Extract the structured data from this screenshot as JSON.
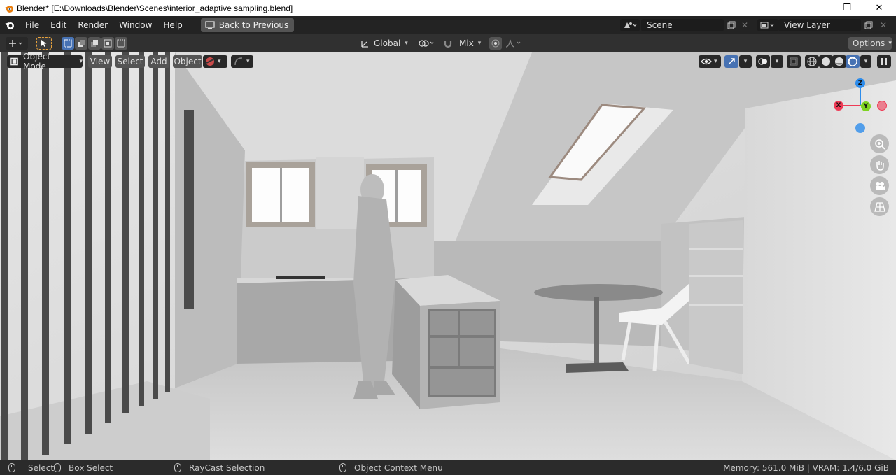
{
  "window": {
    "title": "Blender* [E:\\Downloads\\Blender\\Scenes\\interior_adaptive sampling.blend]",
    "minimize": "—",
    "maximize": "❐",
    "close": "✕"
  },
  "menubar": {
    "items": [
      "File",
      "Edit",
      "Render",
      "Window",
      "Help"
    ],
    "back_label": "Back to Previous",
    "scene": "Scene",
    "view_layer": "View Layer"
  },
  "toolbar": {
    "orientation": "Global",
    "snap_mode": "Mix",
    "options": "Options"
  },
  "viewport_header": {
    "mode": "Object Mode",
    "menus": [
      "View",
      "Select",
      "Add",
      "Object"
    ]
  },
  "gizmo": {
    "z": "Z",
    "x": "X",
    "y": "Y"
  },
  "statusbar": {
    "select": "Select",
    "box_select": "Box Select",
    "raycast": "RayCast Selection",
    "context_menu": "Object Context Menu",
    "memory": "Memory: 561.0 MiB | VRAM: 1.4/6.0 GiB"
  },
  "colors": {
    "accent": "#4772b3",
    "x_axis": "#ee3a55",
    "y_axis": "#7ed321",
    "z_axis": "#2d8ceb"
  }
}
